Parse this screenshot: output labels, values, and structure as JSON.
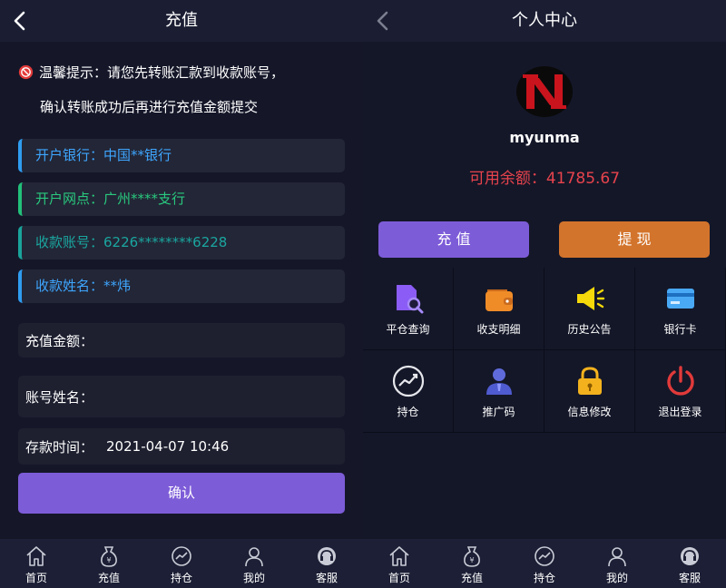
{
  "recharge_page": {
    "title": "充值",
    "notice_line1": "温馨提示：请您先转账汇款到收款账号，",
    "notice_line2": "确认转账成功后再进行充值金额提交",
    "bank": "开户银行：中国**银行",
    "branch": "开户网点：广州****支行",
    "account": "收款账号：6226********6228",
    "name": "收款姓名：**炜",
    "amount_label": "充值金额：",
    "account_name_label": "账号姓名：",
    "deposit_time_label": "存款时间：",
    "deposit_time_value": "2021-04-07 10:46",
    "confirm_label": "确认"
  },
  "profile_page": {
    "title": "个人中心",
    "username": "myunma",
    "balance": "可用余额：41785.67",
    "recharge_label": "充 值",
    "withdraw_label": "提 现",
    "grid": [
      {
        "label": "平仓查询",
        "icon": "search-doc-icon"
      },
      {
        "label": "收支明细",
        "icon": "wallet-icon"
      },
      {
        "label": "历史公告",
        "icon": "megaphone-icon"
      },
      {
        "label": "银行卡",
        "icon": "bank-card-icon"
      },
      {
        "label": "持仓",
        "icon": "trend-chart-icon"
      },
      {
        "label": "推广码",
        "icon": "person-icon"
      },
      {
        "label": "信息修改",
        "icon": "lock-icon"
      },
      {
        "label": "退出登录",
        "icon": "power-icon"
      }
    ]
  },
  "tabbar": {
    "items": [
      {
        "label": "首页",
        "icon": "home-icon"
      },
      {
        "label": "充值",
        "icon": "money-bag-icon"
      },
      {
        "label": "持仓",
        "icon": "chart-circle-icon"
      },
      {
        "label": "我的",
        "icon": "user-icon"
      },
      {
        "label": "客服",
        "icon": "headset-icon"
      }
    ]
  },
  "colors": {
    "accent_purple": "#7d5cd8",
    "accent_orange": "#d3742c",
    "balance_red": "#e7434d",
    "info_blue": "#3ea6ff",
    "info_green": "#29c97f",
    "info_teal": "#1aa6a0"
  }
}
